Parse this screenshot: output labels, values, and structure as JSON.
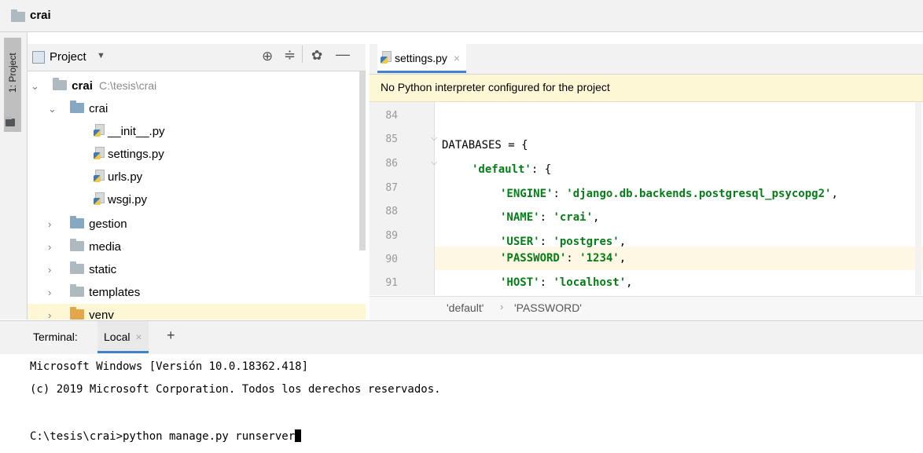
{
  "navbar": {
    "project_name": "crai"
  },
  "tool_stripe": {
    "project_tab": "1: Project"
  },
  "project_panel": {
    "view_label": "Project",
    "dropdown_icon": "chevron-down-icon",
    "actions": [
      "locate-icon",
      "collapse-icon",
      "gear-icon",
      "minimize-icon"
    ],
    "tree": [
      {
        "label": "crai",
        "path": "C:\\tesis\\crai"
      },
      {
        "label": "crai"
      },
      {
        "label": "__init__.py"
      },
      {
        "label": "settings.py"
      },
      {
        "label": "urls.py"
      },
      {
        "label": "wsgi.py"
      },
      {
        "label": "gestion"
      },
      {
        "label": "media"
      },
      {
        "label": "static"
      },
      {
        "label": "templates"
      },
      {
        "label": "venv"
      }
    ]
  },
  "editor": {
    "tab_label": "settings.py",
    "banner_text": "No Python interpreter configured for the project",
    "lines": [
      {
        "num": "84",
        "code": ""
      },
      {
        "num": "85",
        "code": "DATABASES = {"
      },
      {
        "num": "86",
        "key": "'default'",
        "rest": ": {"
      },
      {
        "num": "87",
        "key": "'ENGINE'",
        "sep": ": ",
        "val": "'django.db.backends.postgresql_psycopg2'",
        "end": ","
      },
      {
        "num": "88",
        "key": "'NAME'",
        "sep": ": ",
        "val": "'crai'",
        "end": ","
      },
      {
        "num": "89",
        "key": "'USER'",
        "sep": ": ",
        "val": "'postgres'",
        "end": ","
      },
      {
        "num": "90",
        "key": "'PASSWORD'",
        "sep": ": ",
        "val": "'1234'",
        "end": ","
      },
      {
        "num": "91",
        "key": "'HOST'",
        "sep": ": ",
        "val": "'localhost'",
        "end": ","
      }
    ],
    "breadcrumb": [
      "'default'",
      "'PASSWORD'"
    ],
    "highlight_color": "#fdf7e3"
  },
  "terminal": {
    "title": "Terminal:",
    "tab_label": "Local",
    "add_label": "+",
    "lines": [
      "Microsoft Windows [Versión 10.0.18362.418]",
      "(c) 2019 Microsoft Corporation. Todos los derechos reservados.",
      "",
      "C:\\tesis\\crai>python manage.py runserver"
    ]
  }
}
